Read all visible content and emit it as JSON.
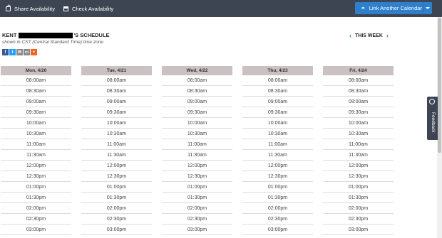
{
  "topbar": {
    "share_label": "Share Availability",
    "check_label": "Check Availability",
    "link_label": "Link Another Calendar",
    "bg_color": "#3d4553",
    "accent_color": "#2f80cc"
  },
  "header": {
    "owner_prefix": "KENT",
    "owner_suffix": "'S SCHEDULE",
    "timezone_note": "shown in CST (Central Standard Time) time zone",
    "week_label": "THIS WEEK"
  },
  "social": [
    {
      "icon": "facebook-icon",
      "glyph": "f",
      "color": "#3b5998"
    },
    {
      "icon": "twitter-icon",
      "glyph": "t",
      "color": "#1da1f2"
    },
    {
      "icon": "email-icon",
      "glyph": "✉",
      "color": "#8a8a8a"
    },
    {
      "icon": "sms-icon",
      "glyph": "▭",
      "color": "#8a8a8a"
    },
    {
      "icon": "plus-icon",
      "glyph": "+",
      "color": "#f26522"
    }
  ],
  "days": [
    {
      "label": "Mon, 4/20"
    },
    {
      "label": "Tue, 4/21"
    },
    {
      "label": "Wed, 4/22"
    },
    {
      "label": "Thu, 4/23"
    },
    {
      "label": "Fri, 4/24"
    }
  ],
  "slots": [
    "08:00am",
    "08:30am",
    "09:00am",
    "09:30am",
    "10:00am",
    "10:30am",
    "11:00am",
    "11:30am",
    "12:00pm",
    "12:30pm",
    "01:00pm",
    "01:30pm",
    "02:00pm",
    "02:30pm",
    "03:00pm"
  ],
  "feedback": {
    "label": "Feedback"
  }
}
